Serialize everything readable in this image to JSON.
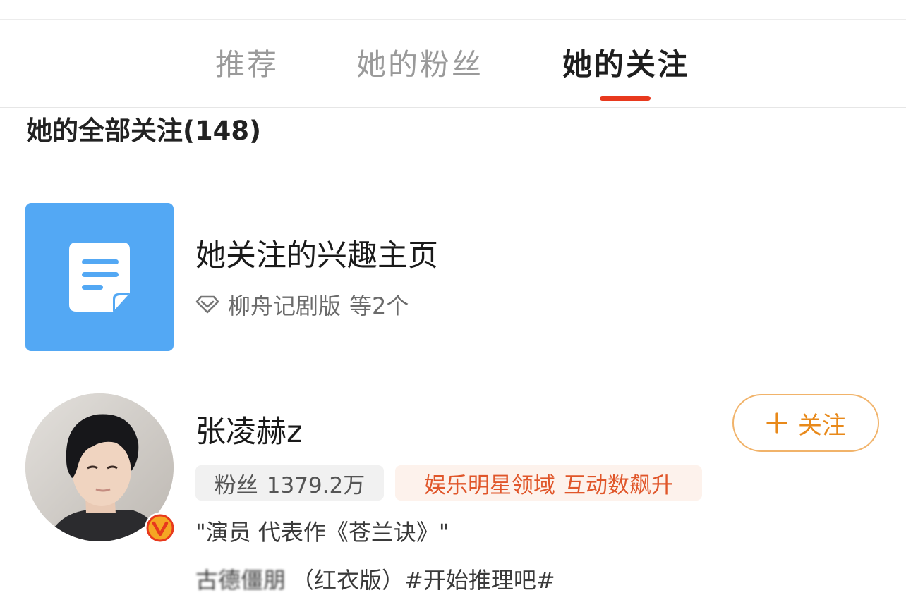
{
  "tabs": [
    {
      "label": "推荐"
    },
    {
      "label": "她的粉丝"
    },
    {
      "label": "她的关注"
    }
  ],
  "active_tab": "她的关注",
  "section_title": "她的全部关注(148)",
  "interest": {
    "title": "她关注的兴趣主页",
    "first_item": "柳舟记剧版",
    "more": "等2个",
    "tile_color": "#53a8f4",
    "icon": "document-icon"
  },
  "user": {
    "name": "张凌赫z",
    "follow_label": "关注",
    "fans_label": "粉丝",
    "fans_count": "1379.2万",
    "tag_domain": "娱乐明星领域",
    "tag_trend": "互动数飙升",
    "bio": "\"演员 代表作《苍兰诀》\"",
    "post_blurred": "古德僵朋",
    "post_text": "（红衣版）#开始推理吧#"
  },
  "colors": {
    "accent": "#e8391d",
    "follow": "#e8891a",
    "tag_text": "#e0562a"
  }
}
